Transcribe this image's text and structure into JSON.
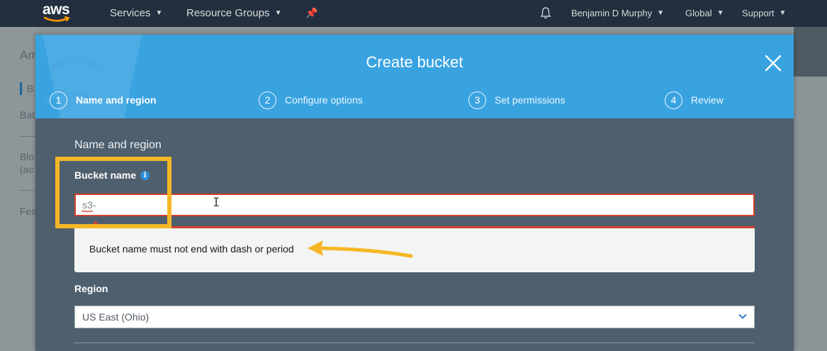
{
  "topnav": {
    "logo_text": "aws",
    "services_label": "Services",
    "resource_groups_label": "Resource Groups",
    "user_label": "Benjamin D Murphy",
    "region_label": "Global",
    "support_label": "Support"
  },
  "background_page": {
    "title_fragment": "Am",
    "nav_fragment_1": "B",
    "nav_fragment_2": "Bat",
    "nav_fragment_3": "Blo",
    "nav_fragment_4": "(ac",
    "nav_fragment_5": "Fea"
  },
  "modal": {
    "title": "Create bucket",
    "steps": [
      {
        "number": "1",
        "label": "Name and region",
        "active": true
      },
      {
        "number": "2",
        "label": "Configure options",
        "active": false
      },
      {
        "number": "3",
        "label": "Set permissions",
        "active": false
      },
      {
        "number": "4",
        "label": "Review",
        "active": false
      }
    ],
    "section_title": "Name and region",
    "bucket_name_label": "Bucket name",
    "bucket_name_value": "s3-",
    "error_message": "Bucket name must not end with dash or period",
    "region_label": "Region",
    "region_value": "US East (Ohio)"
  },
  "colors": {
    "header_blue": "#39a3e0",
    "modal_body": "#4e5f6d",
    "error_red": "#d1412e",
    "annotation_yellow": "#f5b726",
    "nav_dark": "#232f3e"
  },
  "icons": [
    "aws-smile-icon",
    "chevron-down-icon",
    "pin-icon",
    "bell-icon",
    "close-icon",
    "info-icon",
    "text-cursor-icon",
    "arrow-annotation-icon"
  ]
}
